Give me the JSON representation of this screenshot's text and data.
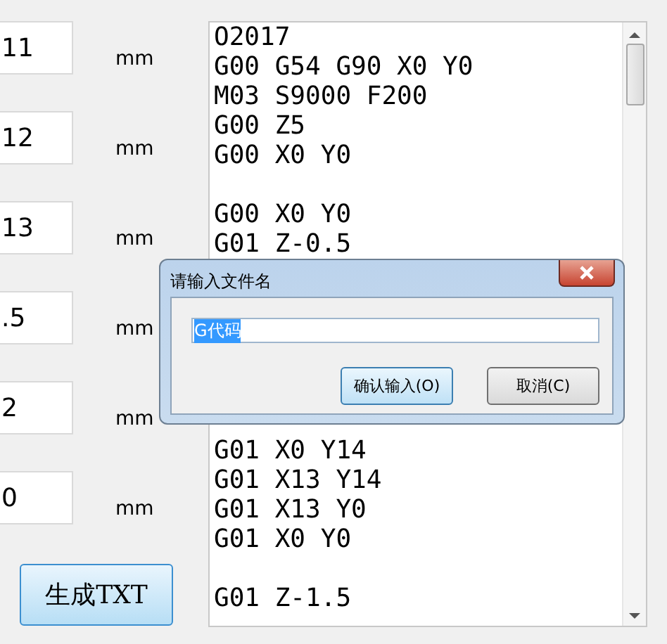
{
  "fields": [
    {
      "value": "11",
      "unit": "mm"
    },
    {
      "value": "12",
      "unit": "mm"
    },
    {
      "value": "13",
      "unit": "mm"
    },
    {
      "value": ".5",
      "unit": "mm"
    },
    {
      "value": "2",
      "unit": "mm"
    },
    {
      "value": "0",
      "unit": "mm"
    }
  ],
  "generate_button": "生成TXT",
  "code_blocks_top": [
    [
      "O2017",
      "G00 G54 G90 X0 Y0",
      "M03 S9000 F200",
      "G00 Z5",
      "G00 X0 Y0"
    ],
    [
      "G00 X0 Y0",
      "G01 Z-0.5"
    ]
  ],
  "code_blocks_bottom": [
    [
      "G01 X0 Y14",
      "G01 X13 Y14",
      "G01 X13 Y0",
      "G01 X0 Y0"
    ],
    [
      "G01 Z-1.5"
    ]
  ],
  "dialog": {
    "title": "请输入文件名",
    "input": {
      "value": "G代码",
      "text_selected": true
    },
    "buttons": [
      {
        "label": "确认输入(O)",
        "focused": true
      },
      {
        "label": "取消(C)",
        "focused": false
      }
    ]
  }
}
